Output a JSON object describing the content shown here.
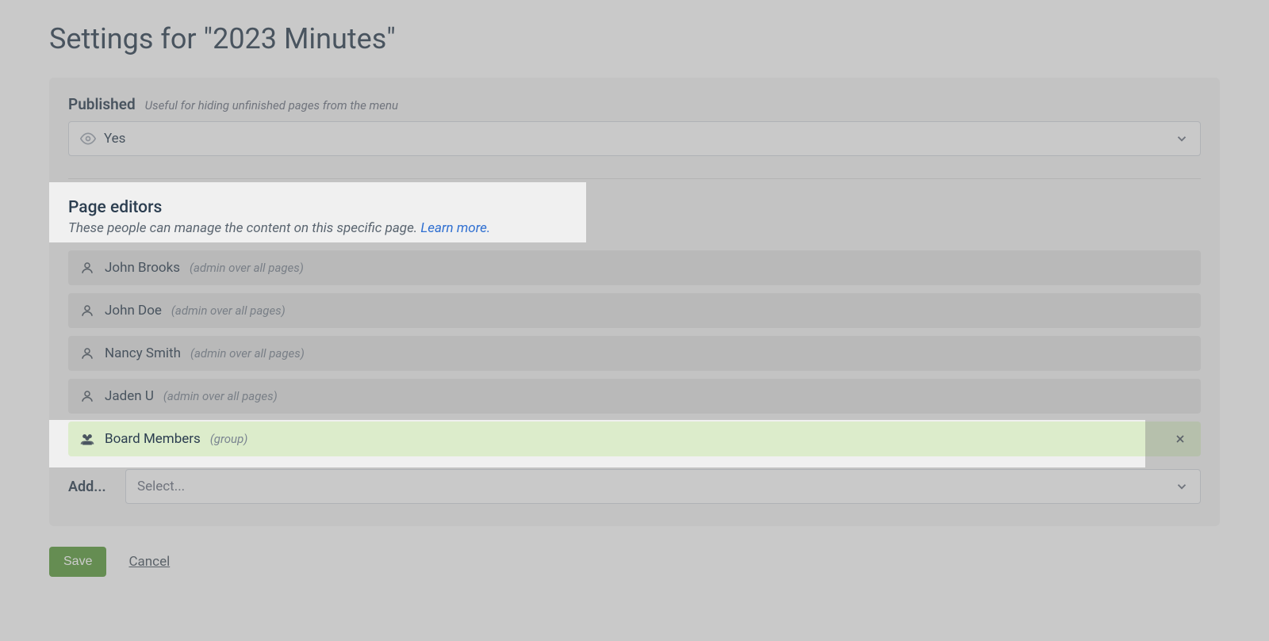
{
  "page_title": "Settings for \"2023 Minutes\"",
  "published": {
    "label": "Published",
    "hint": "Useful for hiding unfinished pages from the menu",
    "value": "Yes"
  },
  "page_editors": {
    "heading": "Page editors",
    "subtext": "These people can manage the content on this specific page.",
    "learn_more": "Learn more.",
    "editors": [
      {
        "name": "John Brooks",
        "note": "(admin over all pages)",
        "type": "user",
        "highlighted": false,
        "removable": false
      },
      {
        "name": "John Doe",
        "note": "(admin over all pages)",
        "type": "user",
        "highlighted": false,
        "removable": false
      },
      {
        "name": "Nancy Smith",
        "note": "(admin over all pages)",
        "type": "user",
        "highlighted": false,
        "removable": false
      },
      {
        "name": "Jaden U",
        "note": "(admin over all pages)",
        "type": "user",
        "highlighted": false,
        "removable": false
      },
      {
        "name": "Board Members",
        "note": "(group)",
        "type": "group",
        "highlighted": true,
        "removable": true
      }
    ],
    "add_label": "Add...",
    "add_placeholder": "Select..."
  },
  "actions": {
    "save": "Save",
    "cancel": "Cancel"
  }
}
